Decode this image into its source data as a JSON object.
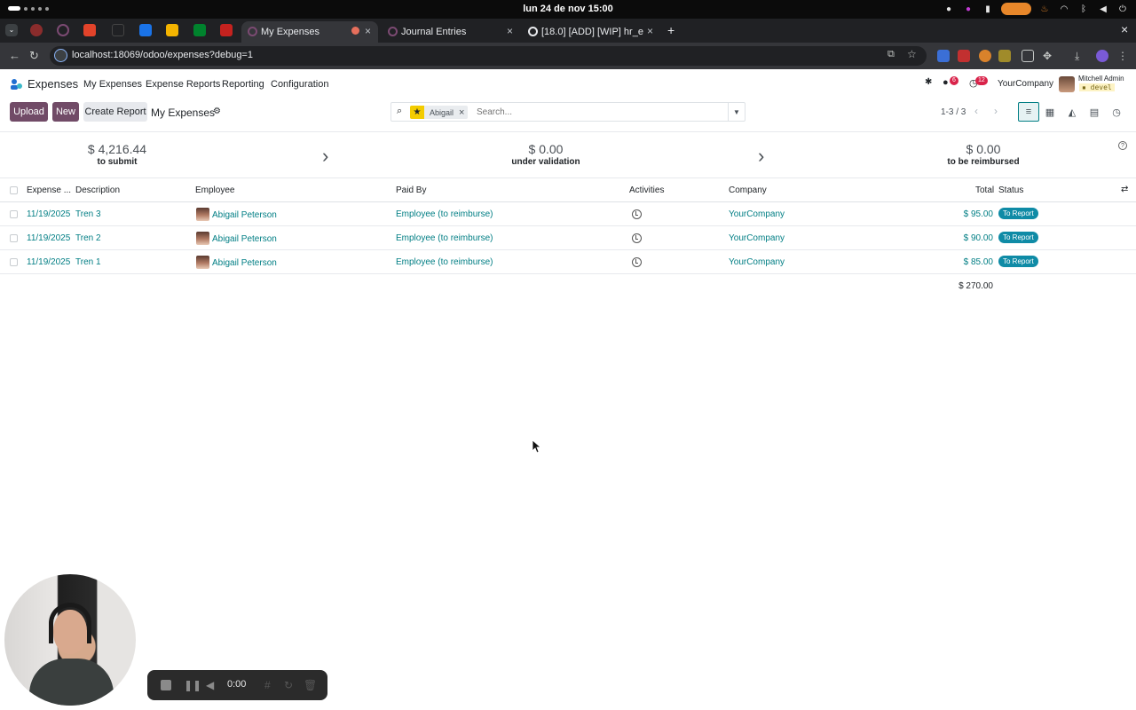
{
  "os": {
    "clock": "lun 24 de nov  15:00"
  },
  "browser": {
    "tabs": [
      {
        "title": "My Expenses",
        "active": true
      },
      {
        "title": "Journal Entries",
        "active": false
      },
      {
        "title": "[18.0] [ADD] [WIP] hr_e",
        "active": false
      }
    ],
    "url": "localhost:18069/odoo/expenses?debug=1",
    "new_tab": "+"
  },
  "navbar": {
    "app_name": "Expenses",
    "menu": [
      "My Expenses",
      "Expense Reports",
      "Reporting",
      "Configuration"
    ],
    "messages_badge": "6",
    "activities_badge": "12",
    "company": "YourCompany",
    "user_name": "Mitchell Admin",
    "db_name": "devel"
  },
  "control_panel": {
    "upload_label": "Upload",
    "new_label": "New",
    "create_report_label": "Create Report",
    "breadcrumb": "My Expenses",
    "facet_label": "Abigail",
    "search_placeholder": "Search...",
    "pager": "1-3 / 3"
  },
  "summary": [
    {
      "amount": "$ 4,216.44",
      "caption": "to submit"
    },
    {
      "amount": "$ 0.00",
      "caption": "under validation"
    },
    {
      "amount": "$ 0.00",
      "caption": "to be reimbursed"
    }
  ],
  "table": {
    "columns": [
      "Expense ...",
      "Description",
      "Employee",
      "Paid By",
      "Activities",
      "Company",
      "Total",
      "Status"
    ],
    "rows": [
      {
        "date": "11/19/2025",
        "description": "Tren 3",
        "employee": "Abigail Peterson",
        "paid_by": "Employee (to reimburse)",
        "company": "YourCompany",
        "total": "$ 95.00",
        "status": "To Report"
      },
      {
        "date": "11/19/2025",
        "description": "Tren 2",
        "employee": "Abigail Peterson",
        "paid_by": "Employee (to reimburse)",
        "company": "YourCompany",
        "total": "$ 90.00",
        "status": "To Report"
      },
      {
        "date": "11/19/2025",
        "description": "Tren 1",
        "employee": "Abigail Peterson",
        "paid_by": "Employee (to reimburse)",
        "company": "YourCompany",
        "total": "$ 85.00",
        "status": "To Report"
      }
    ],
    "grand_total": "$ 270.00"
  },
  "recorder": {
    "time": "0:00"
  },
  "colors": {
    "brand": "#714b67",
    "link": "#017e84",
    "status_badge": "#0f8ba6"
  }
}
